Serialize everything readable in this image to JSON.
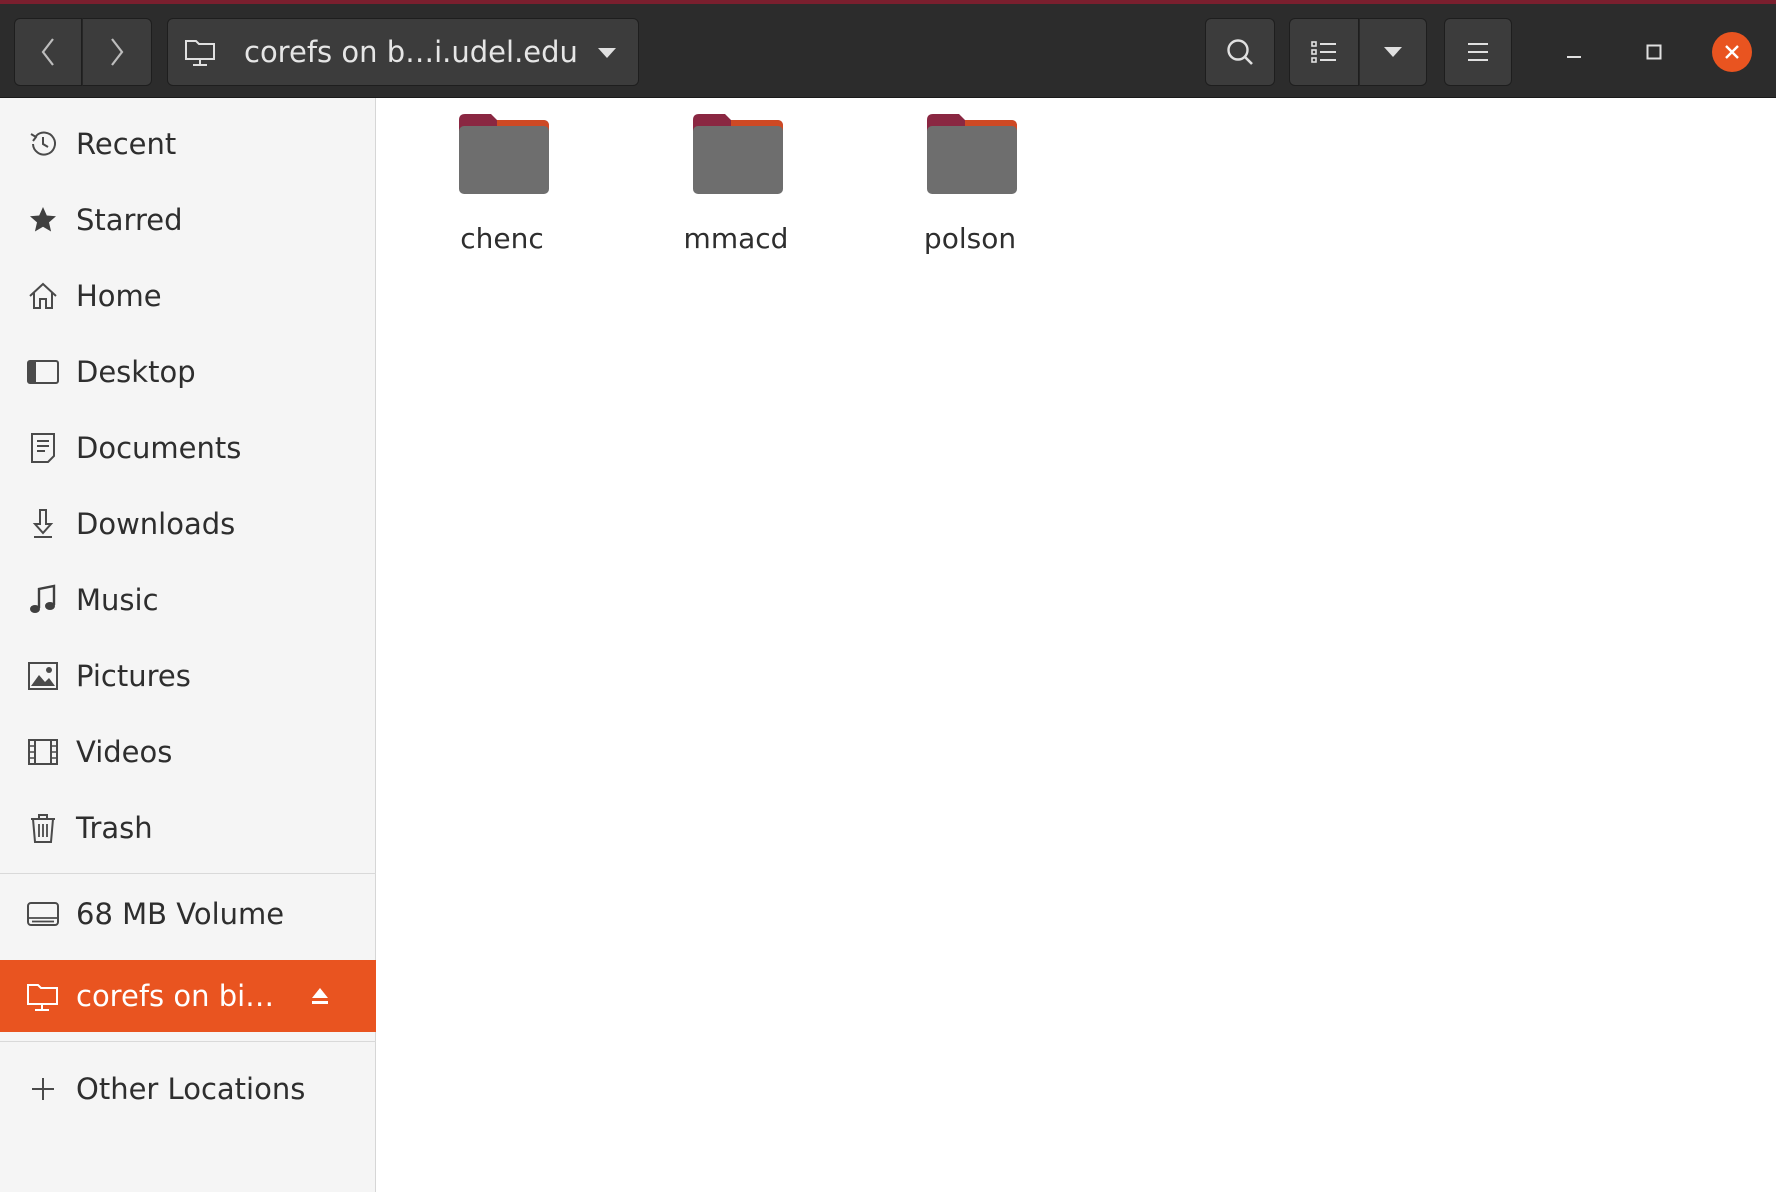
{
  "header": {
    "path_label": "corefs on b…i.udel.edu",
    "buttons": [
      "back",
      "forward",
      "search",
      "list-view",
      "view-options",
      "menu"
    ]
  },
  "window": {
    "controls": [
      "minimize",
      "maximize",
      "close"
    ],
    "close_color": "#e95420"
  },
  "sidebar": {
    "items": [
      {
        "label": "Recent",
        "icon": "clock-icon"
      },
      {
        "label": "Starred",
        "icon": "star-icon"
      },
      {
        "label": "Home",
        "icon": "home-icon"
      },
      {
        "label": "Desktop",
        "icon": "desktop-icon"
      },
      {
        "label": "Documents",
        "icon": "document-icon"
      },
      {
        "label": "Downloads",
        "icon": "download-icon"
      },
      {
        "label": "Music",
        "icon": "music-icon"
      },
      {
        "label": "Pictures",
        "icon": "picture-icon"
      },
      {
        "label": "Videos",
        "icon": "video-icon"
      },
      {
        "label": "Trash",
        "icon": "trash-icon"
      }
    ],
    "devices": [
      {
        "label": "68 MB Volume",
        "icon": "drive-icon"
      },
      {
        "label": "corefs on bi…",
        "icon": "network-folder-icon",
        "active": true,
        "eject": true
      }
    ],
    "other": {
      "label": "Other Locations",
      "icon": "plus-icon"
    }
  },
  "content": {
    "files": [
      {
        "name": "chenc",
        "type": "folder"
      },
      {
        "name": "mmacd",
        "type": "folder"
      },
      {
        "name": "polson",
        "type": "folder"
      }
    ]
  },
  "colors": {
    "accent": "#e95420",
    "header_bg": "#2c2c2c",
    "folder_body": "#6e6e6e",
    "folder_tab": "#8a2742"
  }
}
